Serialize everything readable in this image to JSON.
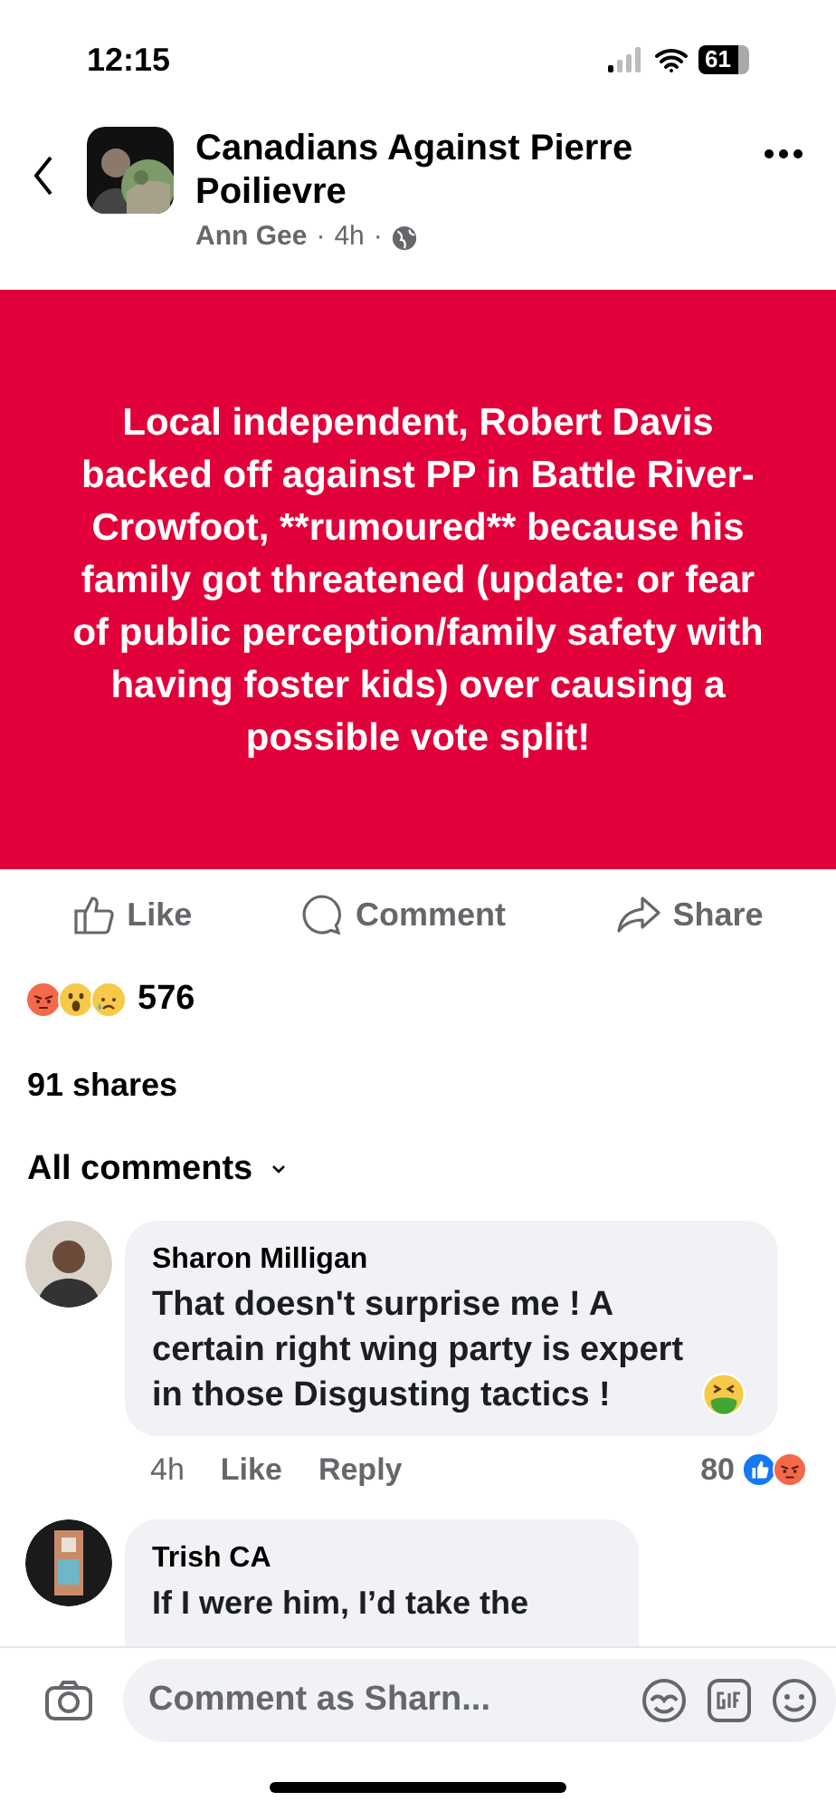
{
  "status_bar": {
    "time": "12:15",
    "battery": "61"
  },
  "header": {
    "group_name": "Canadians Against Pierre Poilievre",
    "author": "Ann Gee",
    "separator_1": "·",
    "time": "4h",
    "separator_2": "·"
  },
  "post": {
    "text": "Local independent, Robert Davis backed off against PP in Battle River-Crowfoot, **rumoured** because his family got threatened (update: or fear of public perception/family safety with having foster kids) over causing a possible vote split!"
  },
  "actions": [
    {
      "kind": "like",
      "label": "Like"
    },
    {
      "kind": "comment",
      "label": "Comment"
    },
    {
      "kind": "share",
      "label": "Share"
    }
  ],
  "reactions": {
    "count": "576"
  },
  "shares": "91 shares",
  "comments_filter": "All comments",
  "comments": [
    {
      "name": "Sharon Milligan",
      "text": "That doesn't surprise me ! A certain right wing party is expert in those Disgusting tactics !",
      "time": "4h",
      "like": "Like",
      "reply": "Reply",
      "count": "80"
    },
    {
      "name": "Trish CA",
      "text": "If I were him, I’d take the"
    }
  ],
  "composer": {
    "placeholder": "Comment as Sharn..."
  }
}
